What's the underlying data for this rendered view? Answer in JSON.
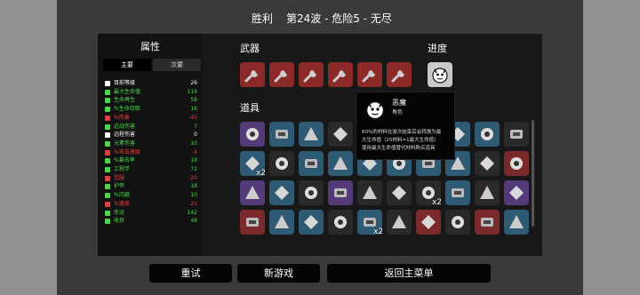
{
  "header": {
    "title": "胜利",
    "wave": "第24波 - 危险5 - 无尽"
  },
  "stats": {
    "title": "属性",
    "tab_primary": "主要",
    "tab_secondary": "次要",
    "rows": [
      {
        "name": "目前等级",
        "value": "26",
        "color": "#ffffff"
      },
      {
        "name": "最大生命值",
        "value": "119",
        "color": "#4cd64c"
      },
      {
        "name": "生命再生",
        "value": "58",
        "color": "#4cd64c"
      },
      {
        "name": "%生命窃取",
        "value": "16",
        "color": "#4cd64c"
      },
      {
        "name": "%伤害",
        "value": "-40",
        "color": "#e04040"
      },
      {
        "name": "近战伤害",
        "value": "7",
        "color": "#4cd64c"
      },
      {
        "name": "远程伤害",
        "value": "0",
        "color": "#ffffff"
      },
      {
        "name": "元素伤害",
        "value": "10",
        "color": "#4cd64c"
      },
      {
        "name": "%攻击速度",
        "value": "-4",
        "color": "#e04040"
      },
      {
        "name": "%暴击率",
        "value": "19",
        "color": "#4cd64c"
      },
      {
        "name": "工程学",
        "value": "72",
        "color": "#4cd64c"
      },
      {
        "name": "范围",
        "value": "-20",
        "color": "#e04040"
      },
      {
        "name": "护甲",
        "value": "18",
        "color": "#4cd64c"
      },
      {
        "name": "%闪避",
        "value": "10",
        "color": "#4cd64c"
      },
      {
        "name": "%速度",
        "value": "-21",
        "color": "#e04040"
      },
      {
        "name": "幸运",
        "value": "142",
        "color": "#4cd64c"
      },
      {
        "name": "收获",
        "value": "48",
        "color": "#4cd64c"
      }
    ]
  },
  "sections": {
    "weapons": "武器",
    "progress": "进度",
    "items": "道具"
  },
  "tooltip": {
    "name": "恶魔",
    "type": "角色",
    "line1": "60%的材料在波次结束后会转换为最",
    "line2": "大生命值（25材料=1最大生命值）",
    "line3": "使用最大生命值替代材料购买道具"
  },
  "item_quantities": {
    "row2_col1": "x2",
    "row3_col7": "x2",
    "row4_col5": "x2"
  },
  "buttons": {
    "retry": "重试",
    "new_game": "新游戏",
    "main_menu": "返回主菜单"
  },
  "colors": {
    "weapon_slot": "#8c2a2a",
    "tier1": "#2a2a2a",
    "tier2": "#2f5a73",
    "tier3": "#553a7a",
    "tier4": "#7a2a2a"
  }
}
